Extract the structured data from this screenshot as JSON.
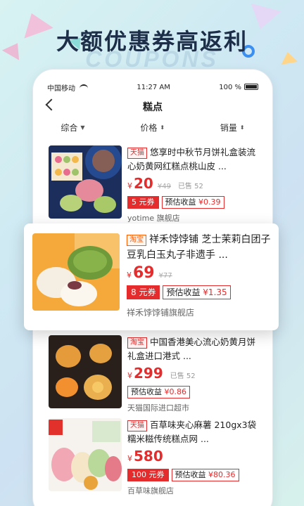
{
  "banner": {
    "headline": "大额优惠券高返利",
    "watermark": "COUPONS"
  },
  "status_bar": {
    "carrier": "中国移动",
    "time": "11:27 AM",
    "battery": "100 %"
  },
  "nav": {
    "title": "糕点"
  },
  "sort": {
    "items": [
      "综合",
      "价格",
      "销量"
    ]
  },
  "products": [
    {
      "platform": "天猫",
      "title": "悠享时中秋节月饼礼盒装流心奶黄网红糕点桃山皮 ...",
      "price": "20",
      "orig_price": "¥49",
      "sold": "已售 52",
      "coupon": "5 元券",
      "estimate_label": "预估收益",
      "estimate_value": "¥0.39",
      "shop": "yotime 旗舰店"
    },
    {
      "platform": "淘宝",
      "title": "祥禾饽饽铺 芝士茉莉白团子豆乳白玉丸子非遗手 ...",
      "price": "69",
      "orig_price": "¥77",
      "sold": "",
      "coupon": "8 元券",
      "estimate_label": "预估收益",
      "estimate_value": "¥1.35",
      "shop": "祥禾饽饽铺旗舰店"
    },
    {
      "platform": "淘宝",
      "title": "中国香港美心流心奶黄月饼礼盒进口港式 ...",
      "price": "299",
      "orig_price": "",
      "sold": "已售 52",
      "coupon": "",
      "estimate_label": "预估收益",
      "estimate_value": "¥0.86",
      "shop": "天猫国际进口超市"
    },
    {
      "platform": "天猫",
      "title": "百草味夹心麻薯 210gx3袋糯米糍传统糕点网 ...",
      "price": "580",
      "orig_price": "",
      "sold": "",
      "coupon": "100 元券",
      "estimate_label": "预估收益",
      "estimate_value": "¥80.36",
      "shop": "百草味旗舰店"
    }
  ],
  "colors": {
    "accent": "#e52b2b",
    "headline": "#1d2f48"
  }
}
